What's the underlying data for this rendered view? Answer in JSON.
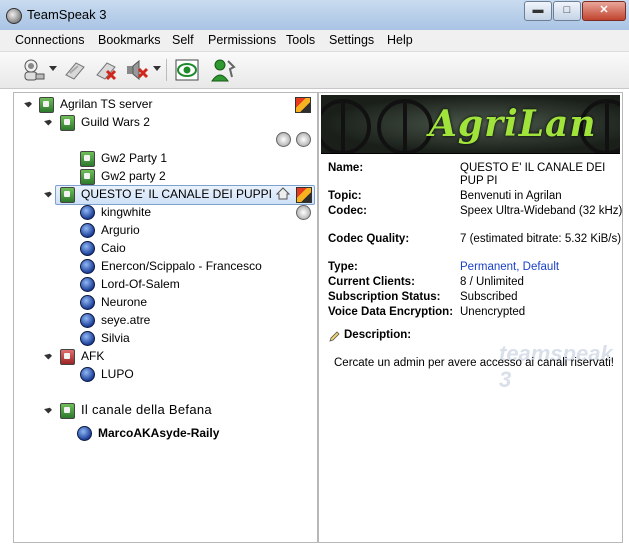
{
  "window": {
    "title": "TeamSpeak 3",
    "minimize_glyph": "▬",
    "maximize_glyph": "□",
    "close_glyph": "✕",
    "icon": "teamspeak-logo-icon"
  },
  "menu": [
    "Connections",
    "Bookmarks",
    "Self",
    "Permissions",
    "Tools",
    "Settings",
    "Help"
  ],
  "toolbar": {
    "icons": [
      "connect-icon",
      "disconnect-icon",
      "mute-microphone-icon",
      "mute-speakers-icon",
      "away-icon",
      "identity-icon"
    ]
  },
  "tree": {
    "server": "Agrilan TS server",
    "channels": [
      {
        "name": "Guild Wars 2",
        "subchannels": [
          "Gw2 Party 1",
          "Gw2 party 2"
        ]
      },
      {
        "name": "QUESTO E' IL CANALE DEI PUPPI",
        "users": [
          "kingwhite",
          "Argurio",
          "Caio",
          "Enercon/Scippalo - Francesco",
          "Lord-Of-Salem",
          "Neurone",
          "seye.atre",
          "Silvia"
        ]
      },
      {
        "name": "AFK",
        "users": [
          "LUPO"
        ]
      },
      {
        "name": "Il canale della Befana",
        "users": [
          "MarcoAKAsyde-Raily"
        ]
      }
    ]
  },
  "info": {
    "banner_text": "AgriLan",
    "watermark": "teamspeak 3",
    "fields": [
      {
        "label": "Name:",
        "value": "QUESTO E' IL CANALE DEI PUP PI"
      },
      {
        "label": "Topic:",
        "value": "Benvenuti in Agrilan"
      },
      {
        "label": "Codec:",
        "value": "Speex Ultra-Wideband (32 kHz)"
      },
      {
        "label": "Codec Quality:",
        "value": "7 (estimated bitrate: 5.32 KiB/s)"
      },
      {
        "label": "Type:",
        "value": "Permanent, Default"
      },
      {
        "label": "Current Clients:",
        "value": "8 / Unlimited"
      },
      {
        "label": "Subscription Status:",
        "value": "Subscribed"
      },
      {
        "label": "Voice Data Encryption:",
        "value": "Unencrypted"
      }
    ],
    "description_label": "Description:",
    "description_text": "Cercate un admin per avere accesso ai canali riservati!"
  }
}
